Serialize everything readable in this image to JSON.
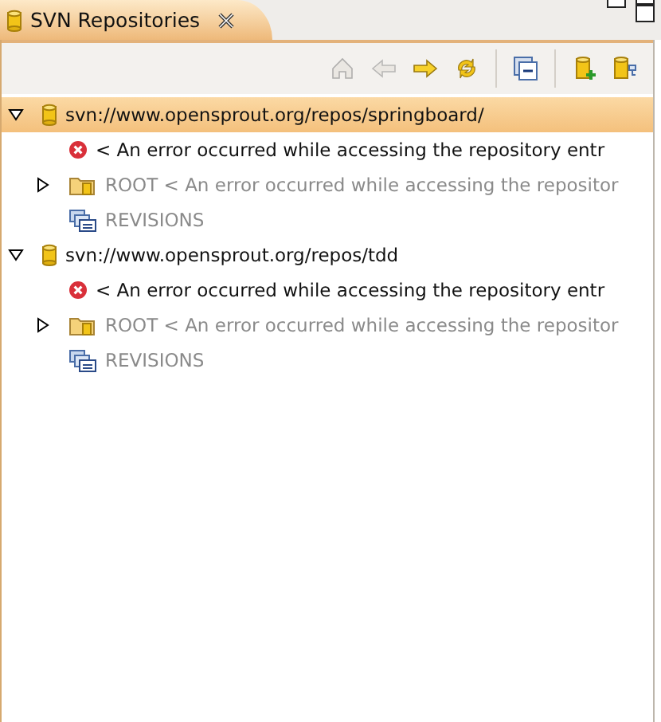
{
  "view_tab": {
    "title": "SVN Repositories"
  },
  "toolbar": [
    {
      "kind": "home",
      "disabled": true
    },
    {
      "kind": "back",
      "disabled": true
    },
    {
      "kind": "forward",
      "disabled": false
    },
    {
      "kind": "sync",
      "disabled": false
    },
    {
      "kind": "collapse",
      "disabled": false
    },
    {
      "kind": "add-repository",
      "disabled": false
    },
    {
      "kind": "repository-tree",
      "disabled": false
    }
  ],
  "tree": [
    {
      "kind": "repository",
      "label": "svn://www.opensprout.org/repos/springboard/",
      "expanded": true,
      "selected": true,
      "children": [
        {
          "kind": "error",
          "label": "< An error occurred while accessing the repository entr",
          "selected": false
        },
        {
          "kind": "folder",
          "label": "ROOT < An error occurred while accessing the repositor",
          "expanded": false,
          "selected": false
        },
        {
          "kind": "revisions",
          "label": "REVISIONS",
          "selected": false
        }
      ]
    },
    {
      "kind": "repository",
      "label": "svn://www.opensprout.org/repos/tdd",
      "expanded": true,
      "selected": false,
      "children": [
        {
          "kind": "error",
          "label": "< An error occurred while accessing the repository entr",
          "selected": false
        },
        {
          "kind": "folder",
          "label": "ROOT < An error occurred while accessing the repositor",
          "expanded": false,
          "selected": false
        },
        {
          "kind": "revisions",
          "label": "REVISIONS",
          "selected": false
        }
      ]
    }
  ]
}
